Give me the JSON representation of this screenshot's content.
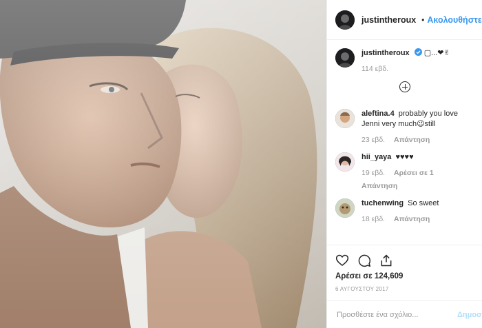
{
  "header": {
    "username": "justintheroux",
    "separator": "•",
    "follow_label": "Ακολουθήστε"
  },
  "caption": {
    "username": "justintheroux",
    "text": "▢...❤✌",
    "time": "114 εβδ."
  },
  "comments": [
    {
      "username": "aleftina.4",
      "text": "probably you love Jenni very much😉still",
      "time": "23 εβδ.",
      "reply_label": "Απάντηση",
      "likes": ""
    },
    {
      "username": "hii_yaya",
      "text": "♥♥♥♥",
      "time": "19 εβδ.",
      "reply_label": "Απάντηση",
      "likes": "Αρέσει σε 1"
    },
    {
      "username": "tuchenwing",
      "text": "So sweet",
      "time": "18 εβδ.",
      "reply_label": "Απάντηση",
      "likes": ""
    }
  ],
  "actions": {
    "likes": "Αρέσει σε 124,609",
    "date": "6 ΑΥΓΟΥΣΤΟΥ 2017"
  },
  "add_comment": {
    "placeholder": "Προσθέστε ένα σχόλιο...",
    "post_label": "Δημοσίευση"
  },
  "colors": {
    "link": "#3897f0",
    "muted": "#999999",
    "text": "#262626"
  }
}
